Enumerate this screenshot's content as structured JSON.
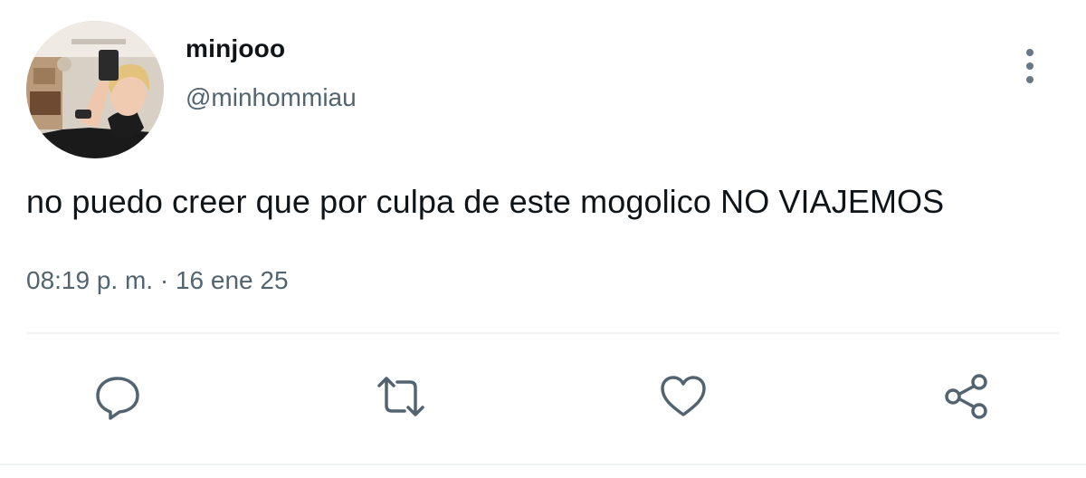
{
  "tweet": {
    "display_name": "minjooo",
    "handle": "@minhommiau",
    "text": "no puedo creer que por culpa de este mogolico NO VIAJEMOS",
    "timestamp": "08:19 p. m. · 16 ene 25"
  },
  "icons": {
    "more": "more-vertical-icon",
    "reply": "reply-icon",
    "retweet": "retweet-icon",
    "like": "heart-icon",
    "share": "share-icon"
  },
  "colors": {
    "text_primary": "#0f1419",
    "text_secondary": "#536471",
    "icon": "#536471",
    "divider": "#eff3f4"
  }
}
